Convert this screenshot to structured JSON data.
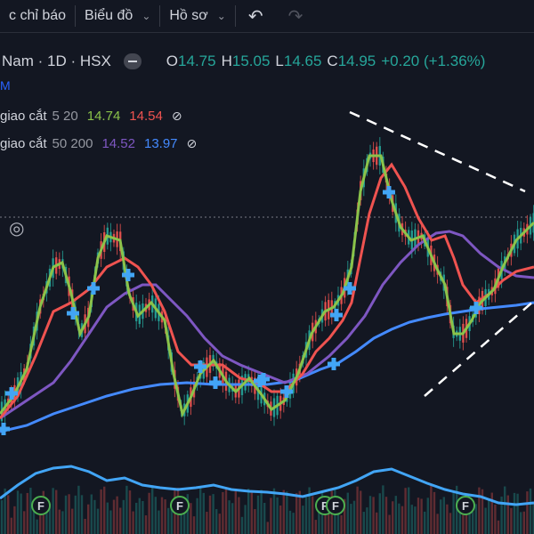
{
  "toolbar": {
    "indicators_label": "c chỉ báo",
    "chart_type_label": "Biểu đồ",
    "profile_label": "Hồ sơ",
    "undo_icon": "undo-icon",
    "redo_icon": "redo-icon"
  },
  "legend": {
    "symbol": "Nam · 1D · HSX",
    "open_label": "O",
    "open": "14.75",
    "high_label": "H",
    "high": "15.05",
    "low_label": "L",
    "low": "14.65",
    "close_label": "C",
    "close": "14.95",
    "change": "+0.20 (+1.36%)",
    "partial_label": "M"
  },
  "indicators": [
    {
      "name": "giao cắt",
      "params": "5 20",
      "v1": "14.74",
      "v2": "14.54",
      "c1": "#4caf50",
      "c2": "#ef5350"
    },
    {
      "name": "giao cắt",
      "params": "50 200",
      "v1": "14.52",
      "v2": "13.97",
      "c1": "#7e57c2",
      "c2": "#2962ff"
    }
  ],
  "colors": {
    "background": "#131722",
    "up": "#26a69a",
    "down": "#ef5350",
    "ma_fast": "#8bc34a",
    "ma_slow": "#ef5350",
    "ma_50": "#7e57c2",
    "ma_200": "#448aff",
    "volume_line": "#42a5f5",
    "cross_marker": "#42a5f5",
    "event_marker": "#4caf50"
  },
  "event_marker_label": "F"
}
